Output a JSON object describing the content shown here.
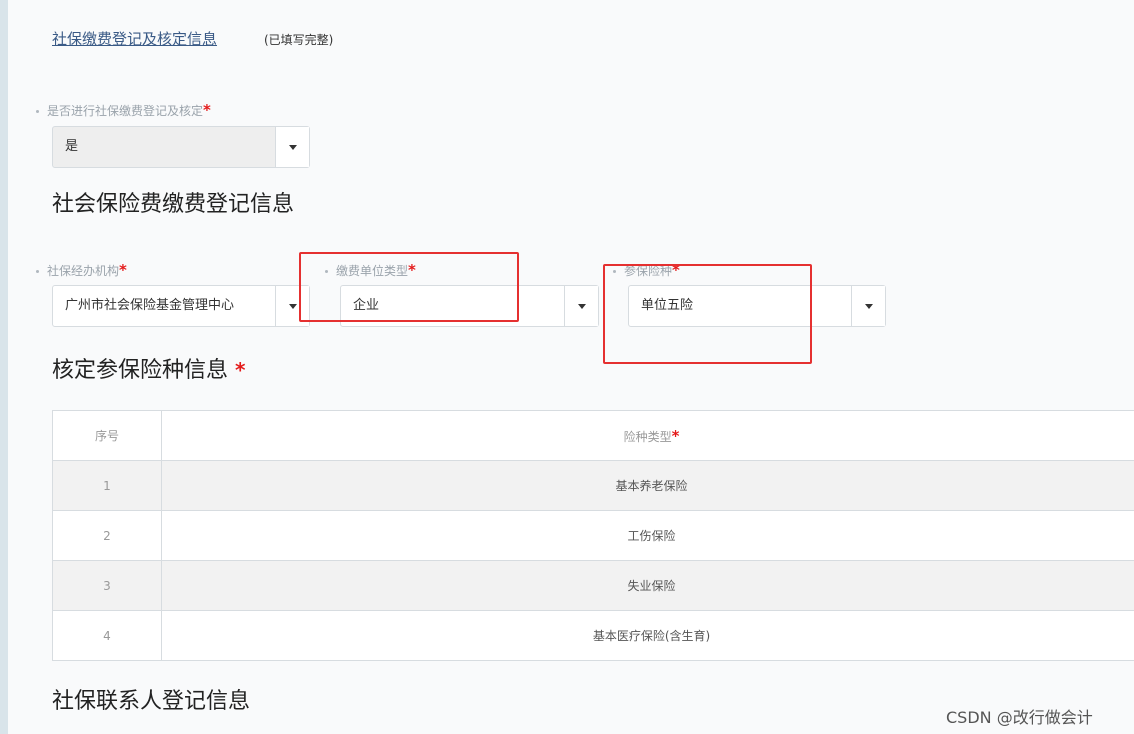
{
  "section": {
    "link_text": "社保缴费登记及核定信息",
    "status_note": "(已填写完整)"
  },
  "register_question": {
    "label": "是否进行社保缴费登记及核定",
    "required_mark": "*",
    "value": "是"
  },
  "heading_registration": "社会保险费缴费登记信息",
  "fields": {
    "agency": {
      "label": "社保经办机构",
      "required_mark": "*",
      "value": "广州市社会保险基金管理中心"
    },
    "unit_type": {
      "label": "缴费单位类型",
      "required_mark": "*",
      "value": "企业"
    },
    "insurance_type": {
      "label": "参保险种",
      "required_mark": "*",
      "value": "单位五险"
    }
  },
  "heading_verify": {
    "text": "核定参保险种信息",
    "required_mark": "*"
  },
  "table": {
    "headers": {
      "index": "序号",
      "type": "险种类型",
      "required_mark": "*"
    },
    "rows": [
      {
        "index": "1",
        "name": "基本养老保险"
      },
      {
        "index": "2",
        "name": "工伤保险"
      },
      {
        "index": "3",
        "name": "失业保险"
      },
      {
        "index": "4",
        "name": "基本医疗保险(含生育)"
      }
    ]
  },
  "heading_contact": "社保联系人登记信息",
  "watermark": "CSDN @改行做会计",
  "colors": {
    "annotation": "#e53030",
    "required": "#e41b1b",
    "link": "#3a5a86"
  },
  "icons": {
    "dropdown": "caret-down-icon",
    "bullet": "dot-icon"
  }
}
